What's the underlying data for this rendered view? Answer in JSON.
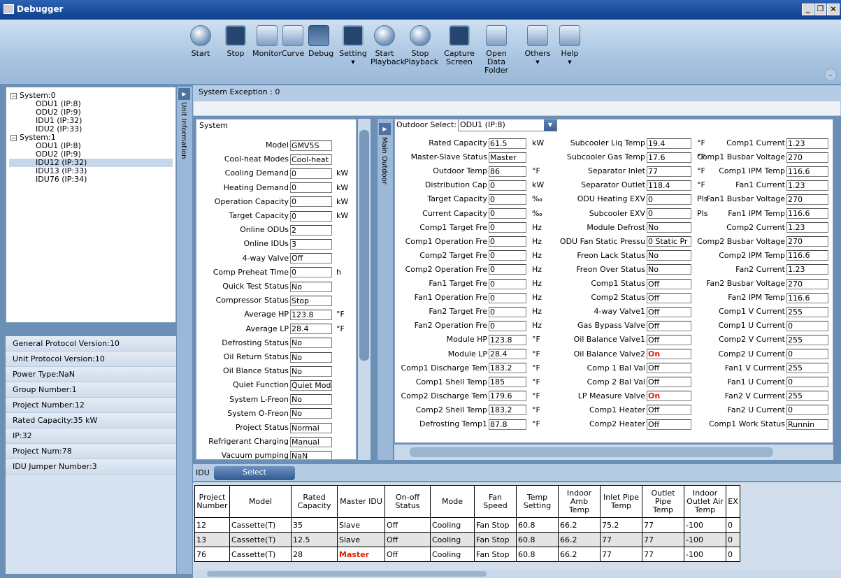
{
  "window": {
    "title": "Debugger"
  },
  "toolbar": [
    {
      "label": "Start",
      "icon": "play-icon"
    },
    {
      "label": "Stop",
      "icon": "pause-icon"
    },
    {
      "label": "Monitor",
      "icon": "magnifier-icon"
    },
    {
      "label": "Curve",
      "icon": "curve-icon"
    },
    {
      "label": "Debug",
      "icon": "monitor-icon"
    },
    {
      "label": "Setting",
      "icon": "cursor-icon",
      "dropdown": true
    },
    {
      "label": "Start Playback",
      "icon": "play-playback-icon"
    },
    {
      "label": "Stop Playback",
      "icon": "stop-playback-icon"
    },
    {
      "label": "Capture Screen",
      "icon": "capture-icon"
    },
    {
      "label": "Open Data Folder",
      "icon": "folder-icon"
    },
    {
      "label": "Others",
      "icon": "checklist-icon",
      "dropdown": true
    },
    {
      "label": "Help",
      "icon": "help-icon",
      "dropdown": true
    }
  ],
  "tree": [
    {
      "label": "System:0",
      "level": 0,
      "expanded": true
    },
    {
      "label": "ODU1 (IP:8)",
      "level": 1
    },
    {
      "label": "ODU2 (IP:9)",
      "level": 1
    },
    {
      "label": "IDU1 (IP:32)",
      "level": 1
    },
    {
      "label": "IDU2 (IP:33)",
      "level": 1
    },
    {
      "label": "System:1",
      "level": 0,
      "expanded": true
    },
    {
      "label": "ODU1 (IP:8)",
      "level": 1
    },
    {
      "label": "ODU2 (IP:9)",
      "level": 1
    },
    {
      "label": "IDU12 (IP:32)",
      "level": 1,
      "selected": true
    },
    {
      "label": "IDU13 (IP:33)",
      "level": 1
    },
    {
      "label": "IDU76 (IP:34)",
      "level": 1
    }
  ],
  "info": [
    "General Protocol Version:10",
    "Unit Protocol Version:10",
    "Power Type:NaN",
    "Group Number:1",
    "Project Number:12",
    "Rated Capacity:35 kW",
    "IP:32",
    "Project Num:78",
    "IDU Jumper Number:3"
  ],
  "unit_info_label": "Unit Information",
  "main_outdoor_label": "Main Outdoor",
  "system_exception": "System Exception : 0",
  "system_panel": {
    "title": "System",
    "rows": [
      {
        "label": "Model",
        "value": "GMV5S",
        "unit": ""
      },
      {
        "label": "Cool-heat Modes",
        "value": "Cool-heat",
        "unit": ""
      },
      {
        "label": "Cooling Demand",
        "value": "0",
        "unit": "kW"
      },
      {
        "label": "Heating Demand",
        "value": "0",
        "unit": "kW"
      },
      {
        "label": "Operation Capacity",
        "value": "0",
        "unit": "kW"
      },
      {
        "label": "Target Capacity",
        "value": "0",
        "unit": "kW"
      },
      {
        "label": "Online ODUs",
        "value": "2",
        "unit": ""
      },
      {
        "label": "Online IDUs",
        "value": "3",
        "unit": ""
      },
      {
        "label": "4-way Valve",
        "value": "Off",
        "unit": ""
      },
      {
        "label": "Comp Preheat Time",
        "value": "0",
        "unit": "h"
      },
      {
        "label": "Quick Test Status",
        "value": "No",
        "unit": ""
      },
      {
        "label": "Compressor Status",
        "value": "Stop",
        "unit": ""
      },
      {
        "label": "Average HP",
        "value": "123.8",
        "unit": "°F"
      },
      {
        "label": "Average LP",
        "value": "28.4",
        "unit": "°F"
      },
      {
        "label": "Defrosting Status",
        "value": "No",
        "unit": ""
      },
      {
        "label": "Oil Return Status",
        "value": "No",
        "unit": ""
      },
      {
        "label": "Oil Blance Status",
        "value": "No",
        "unit": ""
      },
      {
        "label": "Quiet Function",
        "value": "Quiet Mod",
        "unit": ""
      },
      {
        "label": "System L-Freon",
        "value": "No",
        "unit": ""
      },
      {
        "label": "System O-Freon",
        "value": "No",
        "unit": ""
      },
      {
        "label": "Project Status",
        "value": "Normal",
        "unit": ""
      },
      {
        "label": "Refrigerant Charging",
        "value": "Manual",
        "unit": ""
      },
      {
        "label": "Vacuum pumping",
        "value": "NaN",
        "unit": ""
      }
    ]
  },
  "outdoor": {
    "select_label": "Outdoor Select:",
    "selected": "ODU1 (IP:8)",
    "col1": [
      {
        "label": "Rated Capacity",
        "value": "61.5",
        "unit": "kW"
      },
      {
        "label": "Master-Slave Status",
        "value": "Master",
        "unit": ""
      },
      {
        "label": "Outdoor Temp",
        "value": "86",
        "unit": "°F"
      },
      {
        "label": "Distribution Cap",
        "value": "0",
        "unit": "kW"
      },
      {
        "label": "Target Capacity",
        "value": "0",
        "unit": "‰"
      },
      {
        "label": "Current Capacity",
        "value": "0",
        "unit": "‰"
      },
      {
        "label": "Comp1 Target Fre",
        "value": "0",
        "unit": "Hz"
      },
      {
        "label": "Comp1 Operation Fre",
        "value": "0",
        "unit": "Hz"
      },
      {
        "label": "Comp2 Target Fre",
        "value": "0",
        "unit": "Hz"
      },
      {
        "label": "Comp2 Operation Fre",
        "value": "0",
        "unit": "Hz"
      },
      {
        "label": "Fan1 Target Fre",
        "value": "0",
        "unit": "Hz"
      },
      {
        "label": "Fan1 Operation Fre",
        "value": "0",
        "unit": "Hz"
      },
      {
        "label": "Fan2 Target Fre",
        "value": "0",
        "unit": "Hz"
      },
      {
        "label": "Fan2 Operation Fre",
        "value": "0",
        "unit": "Hz"
      },
      {
        "label": "Module HP",
        "value": "123.8",
        "unit": "°F"
      },
      {
        "label": "Module LP",
        "value": "28.4",
        "unit": "°F"
      },
      {
        "label": "Comp1 Discharge Tem",
        "value": "183.2",
        "unit": "°F"
      },
      {
        "label": "Comp1 Shell Temp",
        "value": "185",
        "unit": "°F"
      },
      {
        "label": "Comp2 Discharge Tem",
        "value": "179.6",
        "unit": "°F"
      },
      {
        "label": "Comp2 Shell Temp",
        "value": "183.2",
        "unit": "°F"
      },
      {
        "label": "Defrosting Temp1",
        "value": "87.8",
        "unit": "°F"
      }
    ],
    "col2": [
      {
        "label": "Subcooler Liq Temp",
        "value": "19.4",
        "unit": "°F"
      },
      {
        "label": "Subcooler Gas Temp",
        "value": "17.6",
        "unit": "°F"
      },
      {
        "label": "Separator Inlet",
        "value": "77",
        "unit": "°F"
      },
      {
        "label": "Separator Outlet",
        "value": "118.4",
        "unit": "°F"
      },
      {
        "label": "ODU Heating EXV",
        "value": "0",
        "unit": "Pls"
      },
      {
        "label": "Subcooler EXV",
        "value": "0",
        "unit": "Pls"
      },
      {
        "label": "Module Defrost",
        "value": "No",
        "unit": ""
      },
      {
        "label": "ODU Fan Static Pressu",
        "value": "0 Static Pr",
        "unit": ""
      },
      {
        "label": "Freon Lack Status",
        "value": "No",
        "unit": ""
      },
      {
        "label": "Freon Over Status",
        "value": "No",
        "unit": ""
      },
      {
        "label": "Comp1 Status",
        "value": "Off",
        "unit": ""
      },
      {
        "label": "Comp2 Status",
        "value": "Off",
        "unit": ""
      },
      {
        "label": "4-way Valve1",
        "value": "Off",
        "unit": ""
      },
      {
        "label": "Gas Bypass Valve",
        "value": "Off",
        "unit": ""
      },
      {
        "label": "Oil Balance Valve1",
        "value": "Off",
        "unit": ""
      },
      {
        "label": "Oil Balance Valve2",
        "value": "On",
        "unit": ""
      },
      {
        "label": "Comp 1 Bal Val",
        "value": "Off",
        "unit": ""
      },
      {
        "label": "Comp 2 Bal Val",
        "value": "Off",
        "unit": ""
      },
      {
        "label": "LP Measure Valve",
        "value": "On",
        "unit": ""
      },
      {
        "label": "Comp1 Heater",
        "value": "Off",
        "unit": ""
      },
      {
        "label": "Comp2 Heater",
        "value": "Off",
        "unit": ""
      }
    ],
    "col3": [
      {
        "label": "Comp1 Current",
        "value": "1.23",
        "unit": ""
      },
      {
        "label": "Comp1 Busbar Voltage",
        "value": "270",
        "unit": ""
      },
      {
        "label": "Comp1 IPM Temp",
        "value": "116.6",
        "unit": ""
      },
      {
        "label": "Fan1 Current",
        "value": "1.23",
        "unit": ""
      },
      {
        "label": "Fan1 Busbar Voltage",
        "value": "270",
        "unit": ""
      },
      {
        "label": "Fan1 IPM Temp",
        "value": "116.6",
        "unit": ""
      },
      {
        "label": "Comp2 Current",
        "value": "1.23",
        "unit": ""
      },
      {
        "label": "Comp2 Busbar Voltage",
        "value": "270",
        "unit": ""
      },
      {
        "label": "Comp2 IPM Temp",
        "value": "116.6",
        "unit": ""
      },
      {
        "label": "Fan2 Current",
        "value": "1.23",
        "unit": ""
      },
      {
        "label": "Fan2 Busbar Voltage",
        "value": "270",
        "unit": ""
      },
      {
        "label": "Fan2 IPM Temp",
        "value": "116.6",
        "unit": ""
      },
      {
        "label": "Comp1 V Current",
        "value": "255",
        "unit": ""
      },
      {
        "label": "Comp1 U Current",
        "value": "0",
        "unit": ""
      },
      {
        "label": "Comp2 V Current",
        "value": "255",
        "unit": ""
      },
      {
        "label": "Comp2 U Current",
        "value": "0",
        "unit": ""
      },
      {
        "label": "Fan1 V Currrent",
        "value": "255",
        "unit": ""
      },
      {
        "label": "Fan1 U Current",
        "value": "0",
        "unit": ""
      },
      {
        "label": "Fan2 V Currrent",
        "value": "255",
        "unit": ""
      },
      {
        "label": "Fan2 U Current",
        "value": "0",
        "unit": ""
      },
      {
        "label": "Comp1 Work Status",
        "value": "Runnin",
        "unit": ""
      }
    ]
  },
  "idu": {
    "label": "IDU",
    "select_button": "Select",
    "columns": [
      "Project Number",
      "Model",
      "Rated Capacity",
      "Master IDU",
      "On-off Status",
      "Mode",
      "Fan Speed",
      "Temp Setting",
      "Indoor Amb Temp",
      "Inlet Pipe Temp",
      "Outlet Pipe Temp",
      "Indoor Outlet Air Temp",
      "EX"
    ],
    "rows": [
      [
        "12",
        "Cassette(T)",
        "35",
        "Slave",
        "Off",
        "Cooling",
        "Fan Stop",
        "60.8",
        "66.2",
        "75.2",
        "77",
        "-100",
        "0"
      ],
      [
        "13",
        "Cassette(T)",
        "12.5",
        "Slave",
        "Off",
        "Cooling",
        "Fan Stop",
        "60.8",
        "66.2",
        "77",
        "77",
        "-100",
        "0"
      ],
      [
        "76",
        "Cassette(T)",
        "28",
        "Master",
        "Off",
        "Cooling",
        "Fan Stop",
        "60.8",
        "66.2",
        "77",
        "77",
        "-100",
        "0"
      ]
    ]
  }
}
